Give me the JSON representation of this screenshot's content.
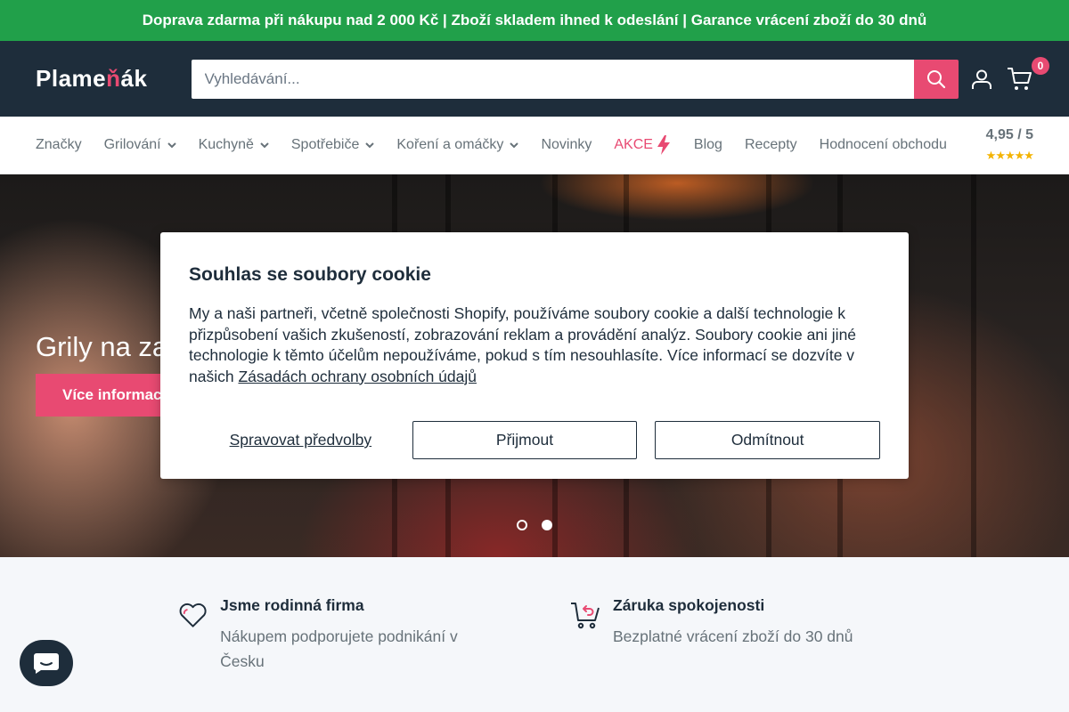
{
  "topbar": {
    "text": "Doprava zdarma při nákupu nad 2 000 Kč | Zboží skladem ihned k odeslání | Garance vrácení zboží do 30 dnů"
  },
  "header": {
    "logo_text_a": "Plame",
    "logo_text_b": "ň",
    "logo_text_c": "ák",
    "search_placeholder": "Vyhledávání...",
    "cart_count": "0"
  },
  "nav": {
    "items": [
      {
        "label": "Značky",
        "dropdown": false
      },
      {
        "label": "Grilování",
        "dropdown": true
      },
      {
        "label": "Kuchyně",
        "dropdown": true
      },
      {
        "label": "Spotřebiče",
        "dropdown": true
      },
      {
        "label": "Koření a omáčky",
        "dropdown": true
      },
      {
        "label": "Novinky",
        "dropdown": false
      },
      {
        "label": "AKCE",
        "dropdown": false
      },
      {
        "label": "Blog",
        "dropdown": false
      },
      {
        "label": "Recepty",
        "dropdown": false
      },
      {
        "label": "Hodnocení obchodu",
        "dropdown": false
      }
    ],
    "rating": "4,95 / 5",
    "stars": "★★★★★"
  },
  "hero": {
    "title": "Grily na za",
    "button_label": "Více informac",
    "slides": 2,
    "active_slide": 2
  },
  "cookie": {
    "title": "Souhlas se soubory cookie",
    "body": "My a naši partneři, včetně společnosti Shopify, používáme soubory cookie a další technologie k přizpůsobení vašich zkušeností, zobrazování reklam a provádění analýz. Soubory cookie ani jiné technologie k těmto účelům nepoužíváme, pokud s tím nesouhlasíte. Více informací se dozvíte v našich ",
    "policy_link": "Zásadách ochrany osobních údajů",
    "manage_label": "Spravovat předvolby",
    "accept_label": "Přijmout",
    "decline_label": "Odmítnout"
  },
  "features": [
    {
      "icon": "heart-icon",
      "title": "Jsme rodinná firma",
      "text": "Nákupem podporujete podnikání v Česku"
    },
    {
      "icon": "cart-return-icon",
      "title": "Záruka spokojenosti",
      "text": "Bezplatné vrácení zboží do 30 dnů"
    }
  ],
  "colors": {
    "accent": "#e84a72",
    "dark": "#1e2d3b",
    "topbar": "#21a04a",
    "star": "#f3b300"
  }
}
